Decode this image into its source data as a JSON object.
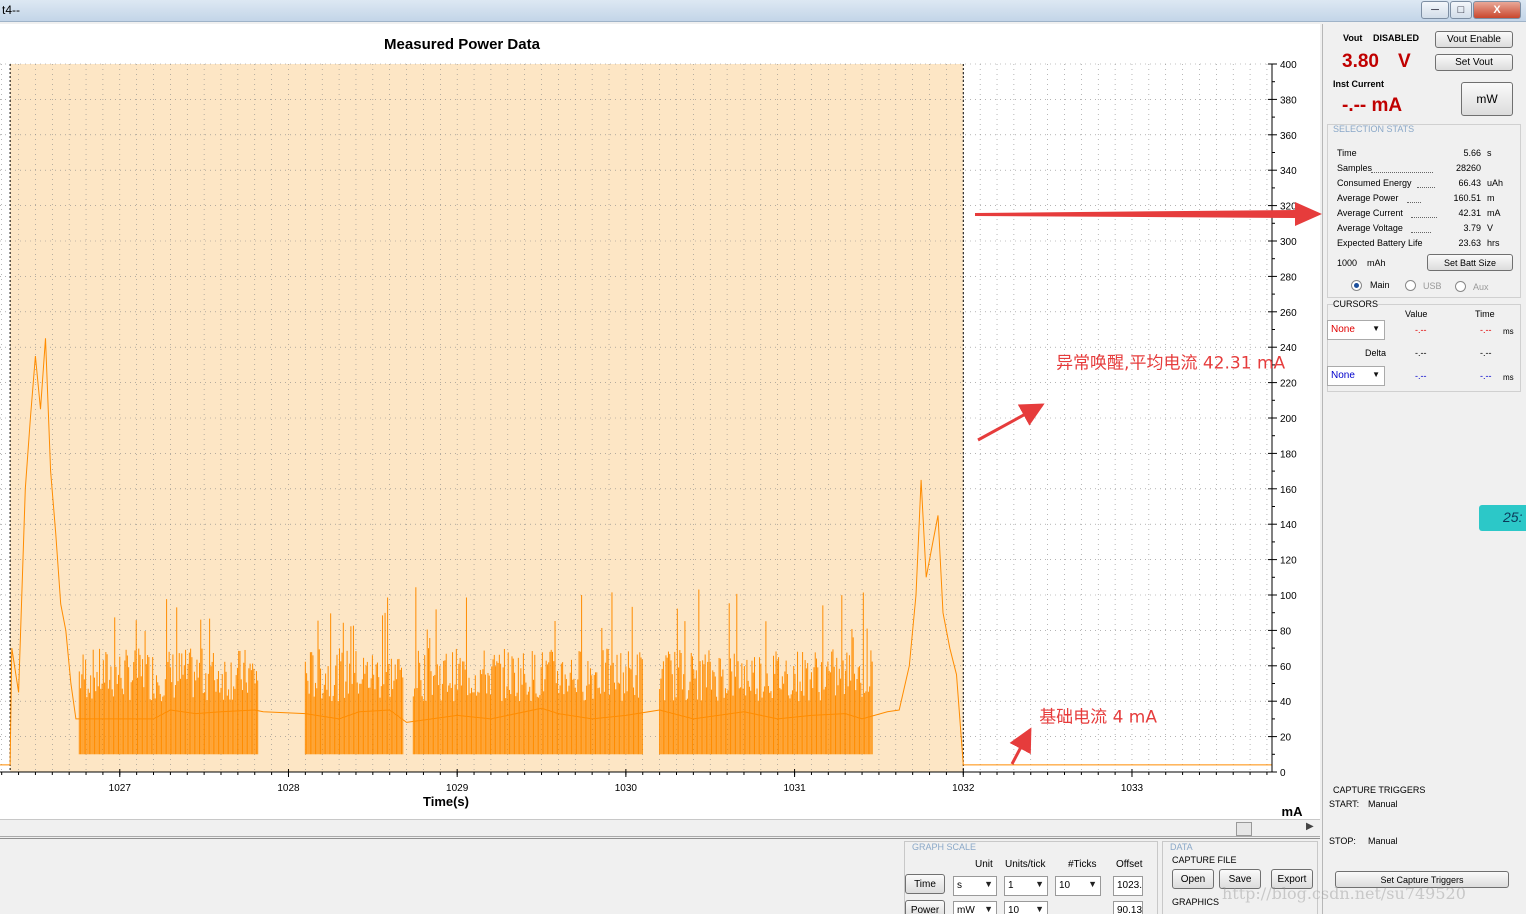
{
  "window": {
    "title": "t4--",
    "buttons": {
      "minimize": "─",
      "maximize": "□",
      "close": "X"
    }
  },
  "colors": {
    "trace": "#ff8c00",
    "selection": "#fde6c5",
    "annotation": "#e63c3c",
    "vout_value": "#c00000",
    "accent_teal": "#2cc8c8"
  },
  "chart": {
    "title": "Measured Power Data",
    "x_label": "Time(s)",
    "y_unit_label": "mA"
  },
  "chart_data": {
    "type": "line",
    "title": "Measured Power Data",
    "xlabel": "Time(s)",
    "ylabel": "mA",
    "xlim": [
      1026.29,
      1033.83
    ],
    "ylim": [
      0,
      400
    ],
    "x_ticks": [
      1027,
      1028,
      1029,
      1030,
      1031,
      1032,
      1033
    ],
    "y_ticks": [
      0,
      20,
      40,
      60,
      80,
      100,
      120,
      140,
      160,
      180,
      200,
      220,
      240,
      260,
      280,
      300,
      320,
      340,
      360,
      380,
      400
    ],
    "selection": {
      "start": 1026.35,
      "end": 1032.0
    },
    "grid": true,
    "y_axis_side": "right",
    "series": [
      {
        "points": [
          [
            1026.29,
            4
          ],
          [
            1026.35,
            4
          ],
          [
            1026.36,
            70
          ],
          [
            1026.4,
            45
          ],
          [
            1026.44,
            160
          ],
          [
            1026.47,
            200
          ],
          [
            1026.5,
            235
          ],
          [
            1026.53,
            205
          ],
          [
            1026.56,
            245
          ],
          [
            1026.59,
            170
          ],
          [
            1026.62,
            135
          ],
          [
            1026.65,
            95
          ],
          [
            1026.68,
            80
          ],
          [
            1026.71,
            50
          ],
          [
            1026.74,
            30
          ],
          [
            1027.2,
            30
          ],
          [
            1027.3,
            35
          ],
          [
            1027.45,
            33
          ],
          [
            1027.6,
            34
          ],
          [
            1027.8,
            35
          ],
          [
            1027.85,
            34
          ],
          [
            1028.1,
            33
          ],
          [
            1028.3,
            30
          ],
          [
            1028.42,
            34
          ],
          [
            1028.6,
            35
          ],
          [
            1028.7,
            28
          ],
          [
            1029.0,
            32
          ],
          [
            1029.2,
            30
          ],
          [
            1029.5,
            36
          ],
          [
            1029.6,
            33
          ],
          [
            1029.8,
            30
          ],
          [
            1030.0,
            32
          ],
          [
            1030.2,
            35
          ],
          [
            1030.4,
            30
          ],
          [
            1030.7,
            34
          ],
          [
            1030.9,
            30
          ],
          [
            1031.1,
            32
          ],
          [
            1031.3,
            33
          ],
          [
            1031.4,
            30
          ],
          [
            1031.55,
            34
          ],
          [
            1031.62,
            35
          ],
          [
            1031.68,
            60
          ],
          [
            1031.72,
            100
          ],
          [
            1031.75,
            165
          ],
          [
            1031.78,
            110
          ],
          [
            1031.82,
            130
          ],
          [
            1031.85,
            145
          ],
          [
            1031.88,
            90
          ],
          [
            1031.92,
            70
          ],
          [
            1031.96,
            55
          ],
          [
            1032.0,
            4
          ],
          [
            1033.83,
            4
          ]
        ]
      }
    ],
    "annotations": [
      {
        "text": "异常唤醒,平均电流 42.31 mA",
        "x": 1032.55,
        "y": 228
      },
      {
        "text": "基础电流 4 mA",
        "x": 1032.45,
        "y": 28
      }
    ]
  },
  "side": {
    "vout_label": "Vout",
    "vout_state": "DISABLED",
    "vout_value": "3.80",
    "vout_unit": "V",
    "vout_enable_btn": "Vout Enable",
    "set_vout_btn": "Set Vout",
    "inst_current_label": "Inst Current",
    "inst_current_value": "-.-- mA",
    "mw_btn": "mW",
    "selection_stats_title": "SELECTION STATS",
    "stats": [
      {
        "name": "Time",
        "value": "5.66",
        "unit": "s"
      },
      {
        "name": "Samples",
        "value": "28260",
        "unit": ""
      },
      {
        "name": "Consumed Energy",
        "value": "66.43",
        "unit": "uAh"
      },
      {
        "name": "Average Power",
        "value": "160.51",
        "unit": "m"
      },
      {
        "name": "Average Current",
        "value": "42.31",
        "unit": "mA"
      },
      {
        "name": "Average Voltage",
        "value": "3.79",
        "unit": "V"
      },
      {
        "name": "Expected Battery Life",
        "value": "23.63",
        "unit": "hrs"
      }
    ],
    "batt_size": "1000",
    "batt_unit": "mAh",
    "set_batt_btn": "Set Batt Size",
    "radios": [
      "Main",
      "USB",
      "Aux"
    ],
    "cursors_title": "CURSORS",
    "cursor_value_header": "Value",
    "cursor_time_header": "Time",
    "cursor1_select": "None",
    "cursor2_select": "None",
    "cursor_dashes": "-.--",
    "cursor_ms": "ms",
    "delta_label": "Delta",
    "capture_triggers_title": "CAPTURE TRIGGERS",
    "start_label": "START:",
    "start_value": "Manual",
    "stop_label": "STOP:",
    "stop_value": "Manual",
    "set_capture_btn": "Set Capture Triggers",
    "teal_tab_text": "25:"
  },
  "bottom": {
    "graph_scale_title": "GRAPH SCALE",
    "unit_header": "Unit",
    "units_tick_header": "Units/tick",
    "ticks_header": "#Ticks",
    "offset_header": "Offset",
    "time_btn": "Time",
    "power_btn": "Power",
    "time_unit": "s",
    "time_units_tick": "1",
    "time_ticks": "10",
    "time_offset": "1023.",
    "power_unit": "mW",
    "power_units_tick": "10",
    "power_offset": "90.13",
    "data_title": "DATA",
    "capture_file_label": "CAPTURE FILE",
    "open_btn": "Open",
    "save_btn": "Save",
    "export_btn": "Export",
    "graphics_label": "GRAPHICS",
    "watermark": "http://blog.csdn.net/su749520"
  }
}
